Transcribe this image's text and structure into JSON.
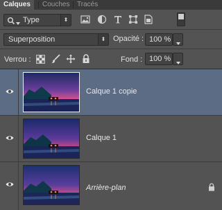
{
  "tabs": [
    {
      "label": "Calques",
      "active": true
    },
    {
      "label": "Couches",
      "active": false
    },
    {
      "label": "Tracés",
      "active": false
    }
  ],
  "filter": {
    "kind_label": "Type"
  },
  "blend": {
    "mode": "Superposition",
    "opacity_label": "Opacité :",
    "opacity_value": "100 %"
  },
  "lock": {
    "label": "Verrou :",
    "fill_label": "Fond :",
    "fill_value": "100 %"
  },
  "layers": [
    {
      "name": "Calque 1 copie",
      "selected": true,
      "italic": false,
      "locked": false
    },
    {
      "name": "Calque 1",
      "selected": false,
      "italic": false,
      "locked": false
    },
    {
      "name": "Arrière-plan",
      "selected": false,
      "italic": true,
      "locked": true
    }
  ],
  "colors": {
    "panel_bg": "#535353",
    "selection": "#5c6c84",
    "tab_bar": "#3a3a3a"
  }
}
